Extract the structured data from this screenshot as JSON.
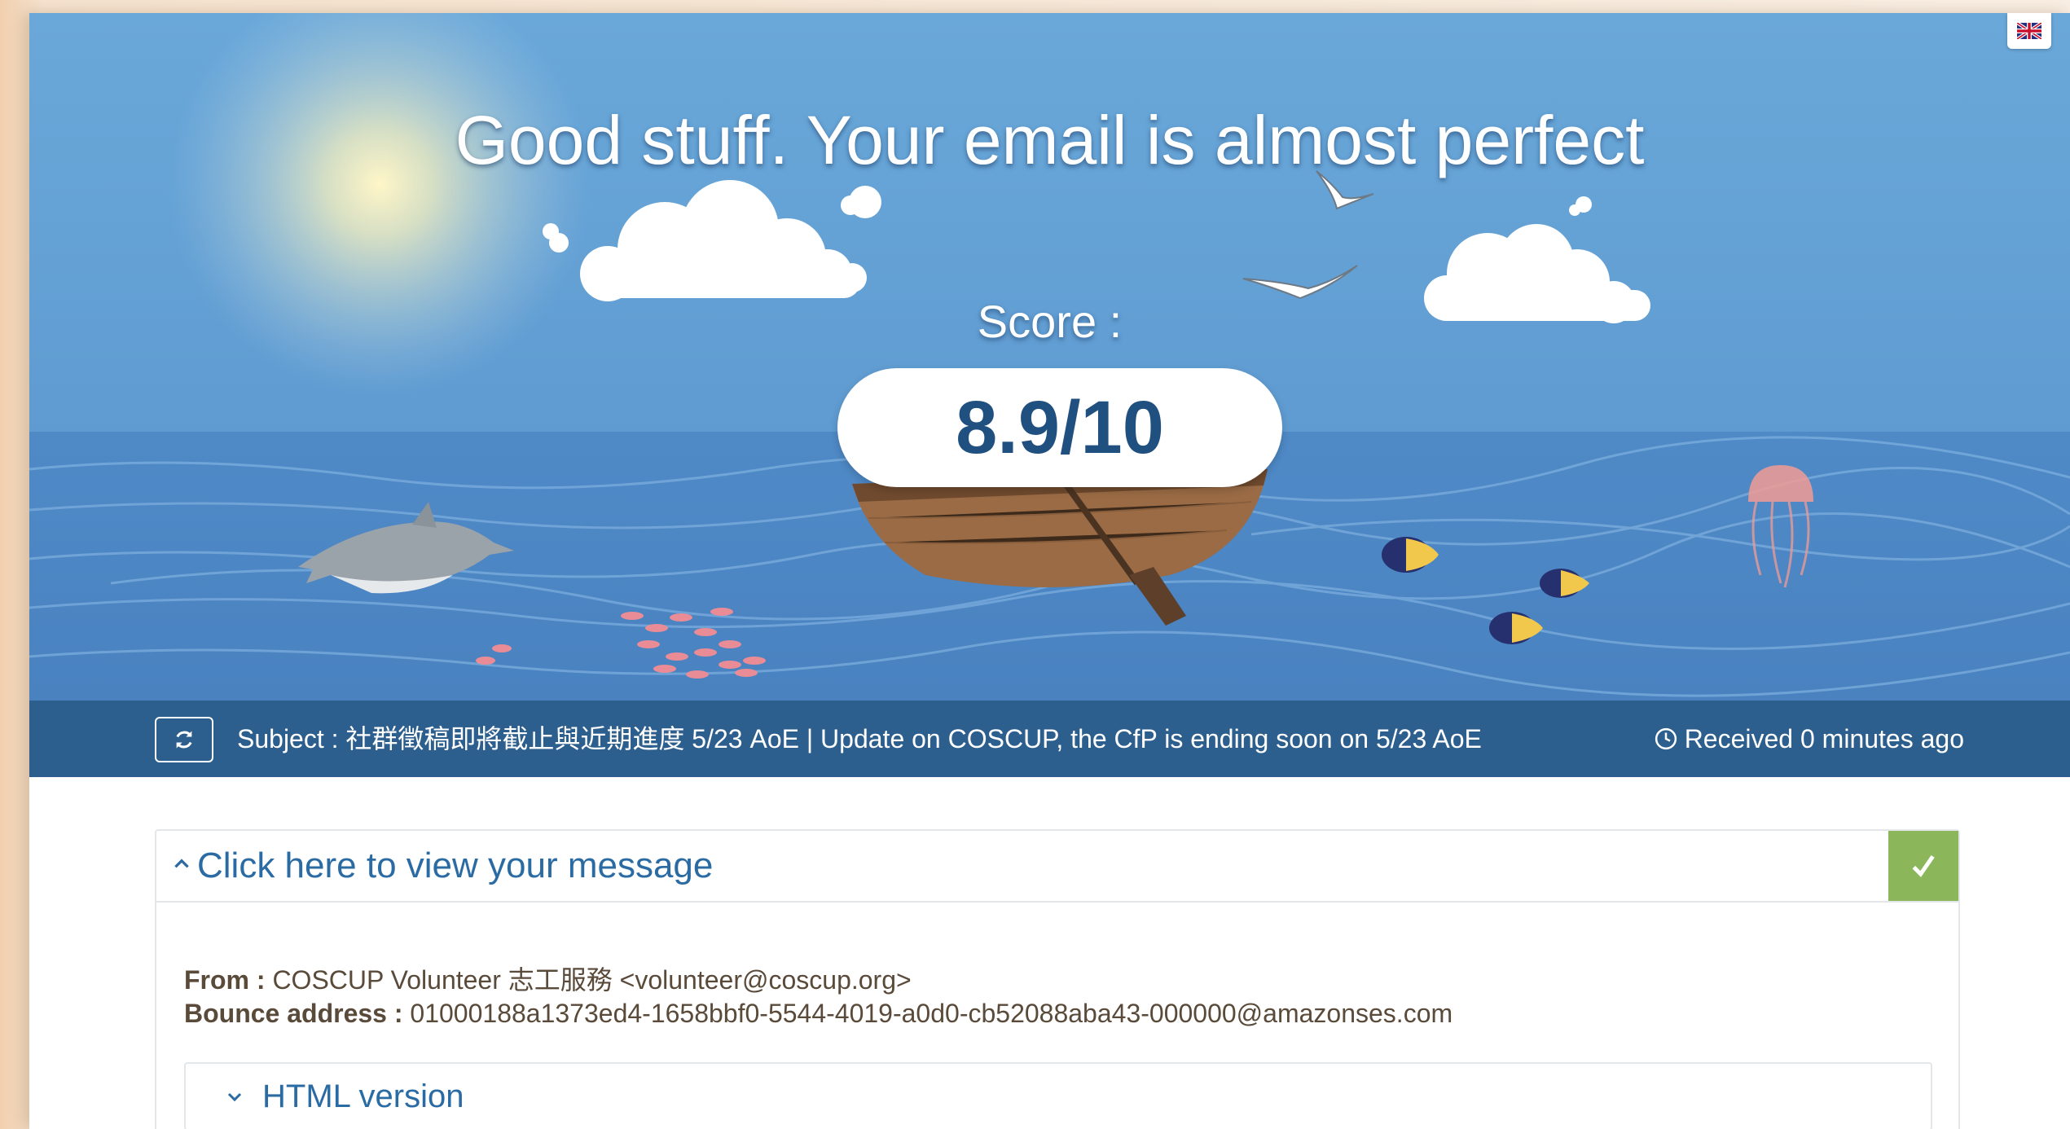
{
  "hero": {
    "headline": "Good stuff. Your email is almost perfect",
    "score_label": "Score :",
    "score_value": "8.9/10",
    "score_numeric": 8.9,
    "score_max": 10
  },
  "language_button": {
    "icon": "uk-flag-icon"
  },
  "subject_bar": {
    "refresh_icon": "refresh-icon",
    "subject": "Subject : 社群徵稿即將截止與近期進度 5/23 AoE | Update on COSCUP, the CfP is ending soon on 5/23 AoE",
    "clock_icon": "clock-icon",
    "received": "Received 0 minutes ago"
  },
  "message_panel": {
    "title": "Click here to view your message",
    "status_icon": "checkmark-icon",
    "from_label": "From :",
    "from_value": "COSCUP Volunteer 志工服務 <volunteer@coscup.org>",
    "bounce_label": "Bounce address :",
    "bounce_value": "01000188a1373ed4-1658bbf0-5544-4019-a0d0-cb52088aba43-000000@amazonses.com",
    "html_version_label": "HTML version"
  },
  "colors": {
    "sky": "#6aa3d5",
    "sea": "#4b86c4",
    "subject_bar": "#2d5f8e",
    "score_text": "#20507f",
    "link_blue": "#2b6ba3",
    "success_green": "#8bb659"
  }
}
